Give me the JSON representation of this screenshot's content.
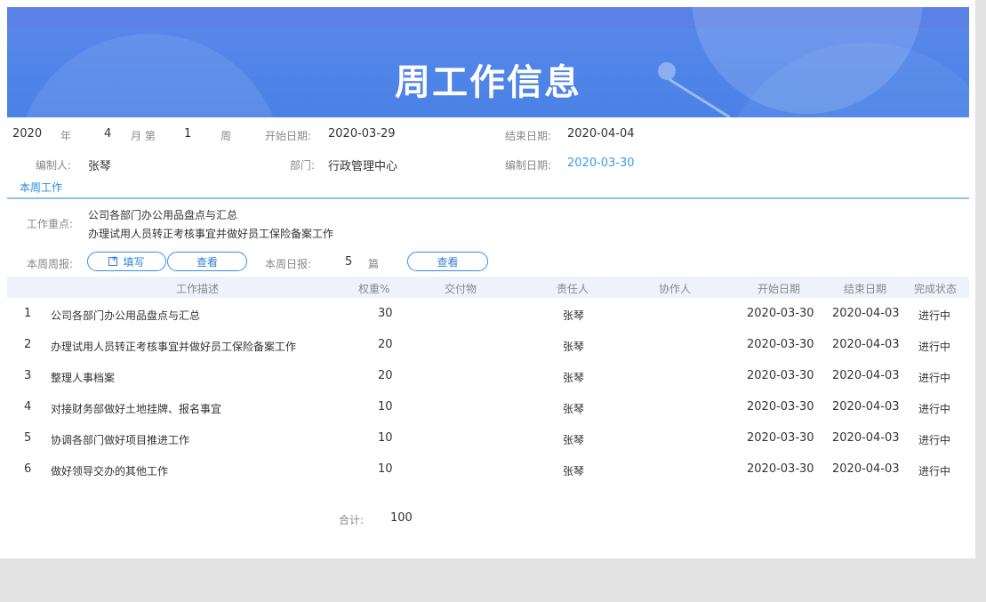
{
  "banner": {
    "title": "周工作信息"
  },
  "period": {
    "year": "2020",
    "year_unit": "年",
    "month": "4",
    "month_unit": "月 第",
    "week": "1",
    "week_unit": "周",
    "start_label": "开始日期:",
    "start_value": "2020-03-29",
    "end_label": "结束日期:",
    "end_value": "2020-04-04"
  },
  "meta": {
    "author_label": "编制人:",
    "author": "张琴",
    "dept_label": "部门:",
    "dept": "行政管理中心",
    "date_label": "编制日期:",
    "date": "2020-03-30"
  },
  "section": {
    "tab": "本周工作"
  },
  "focus": {
    "label": "工作重点:",
    "lines": [
      "公司各部门办公用品盘点与汇总",
      "办理试用人员转正考核事宜并做好员工保险备案工作"
    ]
  },
  "reports": {
    "weekly_label": "本周周报:",
    "write_button": "填写",
    "view_button": "查看",
    "daily_label": "本周日报:",
    "daily_count": "5",
    "daily_unit": "篇",
    "daily_view_button": "查看"
  },
  "table": {
    "headers": [
      "工作描述",
      "权重%",
      "交付物",
      "责任人",
      "协作人",
      "开始日期",
      "结束日期",
      "完成状态"
    ],
    "rows": [
      {
        "no": "1",
        "desc": "公司各部门办公用品盘点与汇总",
        "weight": "30",
        "owner": "张琴",
        "start": "2020-03-30",
        "end": "2020-04-03",
        "status": "进行中"
      },
      {
        "no": "2",
        "desc": "办理试用人员转正考核事宜并做好员工保险备案工作",
        "weight": "20",
        "owner": "张琴",
        "start": "2020-03-30",
        "end": "2020-04-03",
        "status": "进行中"
      },
      {
        "no": "3",
        "desc": "整理人事档案",
        "weight": "20",
        "owner": "张琴",
        "start": "2020-03-30",
        "end": "2020-04-03",
        "status": "进行中"
      },
      {
        "no": "4",
        "desc": "对接财务部做好土地挂牌、报名事宜",
        "weight": "10",
        "owner": "张琴",
        "start": "2020-03-30",
        "end": "2020-04-03",
        "status": "进行中"
      },
      {
        "no": "5",
        "desc": "协调各部门做好项目推进工作",
        "weight": "10",
        "owner": "张琴",
        "start": "2020-03-30",
        "end": "2020-04-03",
        "status": "进行中"
      },
      {
        "no": "6",
        "desc": "做好领导交办的其他工作",
        "weight": "10",
        "owner": "张琴",
        "start": "2020-03-30",
        "end": "2020-04-03",
        "status": "进行中"
      }
    ],
    "total_label": "合计:",
    "total_value": "100"
  }
}
